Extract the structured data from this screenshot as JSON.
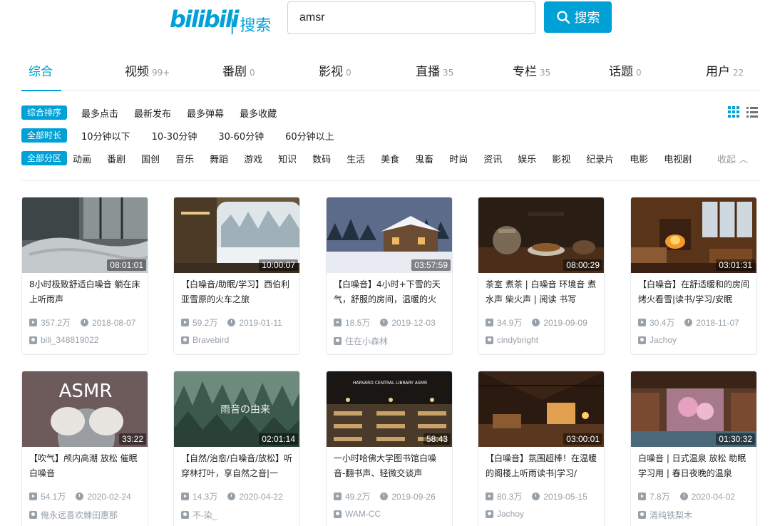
{
  "header": {
    "logo": "bilibili",
    "logo_suffix": "| 搜索",
    "search_value": "amsr",
    "search_button": "搜索",
    "brand_color": "#00a1d6"
  },
  "tabs": [
    {
      "label": "综合",
      "count": "",
      "active": true
    },
    {
      "label": "视频",
      "count": "99+"
    },
    {
      "label": "番剧",
      "count": "0"
    },
    {
      "label": "影视",
      "count": "0"
    },
    {
      "label": "直播",
      "count": "35"
    },
    {
      "label": "专栏",
      "count": "35"
    },
    {
      "label": "话题",
      "count": "0"
    },
    {
      "label": "用户",
      "count": "22"
    }
  ],
  "filters": {
    "sort": {
      "active": "综合排序",
      "options": [
        "最多点击",
        "最新发布",
        "最多弹幕",
        "最多收藏"
      ]
    },
    "duration": {
      "active": "全部时长",
      "options": [
        "10分钟以下",
        "10-30分钟",
        "30-60分钟",
        "60分钟以上"
      ]
    },
    "zone": {
      "active": "全部分区",
      "options": [
        "动画",
        "番剧",
        "国创",
        "音乐",
        "舞蹈",
        "游戏",
        "知识",
        "数码",
        "生活",
        "美食",
        "鬼畜",
        "时尚",
        "资讯",
        "娱乐",
        "影视",
        "纪录片",
        "电影",
        "电视剧"
      ]
    },
    "collapse": "收起"
  },
  "videos": [
    {
      "duration": "08:01:01",
      "title": "8小时极致舒适白噪音 躺在床上听雨声",
      "views": "357.2万",
      "date": "2018-08-07",
      "uploader": "bili_348819022"
    },
    {
      "duration": "10:00:07",
      "title": "【白噪音/助眠/学习】西伯利亚雪原的火车之旅",
      "views": "59.2万",
      "date": "2019-01-11",
      "uploader": "Bravebird"
    },
    {
      "duration": "03:57:59",
      "title": "【白噪音】4小时+下雪的天气，舒服的房间，温暖的火",
      "views": "18.5万",
      "date": "2019-12-03",
      "uploader": "住在小森林"
    },
    {
      "duration": "08:00:29",
      "title": "茶室 煮茶 | 白噪音 环境音 煮水声 柴火声 | 阅读 书写",
      "views": "34.9万",
      "date": "2019-09-09",
      "uploader": "cindybright"
    },
    {
      "duration": "03:01:31",
      "title": "【白噪音】在舒适暖和的房间烤火看雪|读书/学习/安眠",
      "views": "30.4万",
      "date": "2018-11-07",
      "uploader": "Jachoy"
    },
    {
      "duration": "33:22",
      "title": "【吹气】颅内高潮 放松 催眠 白噪音",
      "views": "54.1万",
      "date": "2020-02-24",
      "uploader": "俺永远喜欢棘田惠那"
    },
    {
      "duration": "02:01:14",
      "title": "【自然/治愈/白噪音/放松】听穿林打叶，享自然之音|一",
      "views": "14.3万",
      "date": "2020-04-22",
      "uploader": "不-染_"
    },
    {
      "duration": "58:43",
      "title": "一小时哈佛大学图书馆白噪音-翻书声、轻微交谈声",
      "views": "49.2万",
      "date": "2019-09-26",
      "uploader": "WAM-CC"
    },
    {
      "duration": "03:00:01",
      "title": "【白噪音】氛围超棒！在温暖的阁楼上听雨读书|学习/",
      "views": "80.3万",
      "date": "2019-05-15",
      "uploader": "Jachoy"
    },
    {
      "duration": "01:30:32",
      "title": "白噪音 | 日式温泉 放松 助眠 学习用 | 春日夜晚的温泉",
      "views": "7.8万",
      "date": "2020-04-02",
      "uploader": "清纯铁梨木"
    }
  ],
  "thumb_text": {
    "asmr": "ASMR",
    "rain": "雨音の由来",
    "harvard": "HARVARD CENTRAL LIBRARY ASMR"
  }
}
